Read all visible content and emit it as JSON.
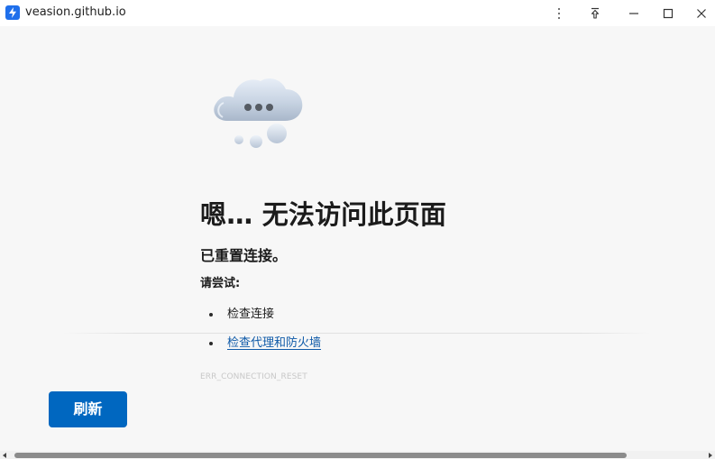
{
  "window": {
    "title": "veasion.github.io",
    "icon": "browser-app-icon",
    "controls": {
      "more": "more-options-icon",
      "pin": "pin-to-top-icon",
      "minimize": "minimize-icon",
      "maximize": "maximize-icon",
      "close": "close-icon"
    }
  },
  "error_page": {
    "illustration": "cloud-connection-error-icon",
    "headline": "嗯… 无法访问此页面",
    "subhead": "已重置连接。",
    "try_label": "请尝试:",
    "suggestions": [
      {
        "text": "检查连接",
        "is_link": false
      },
      {
        "text": "检查代理和防火墙",
        "is_link": true
      }
    ],
    "error_code": "ERR_CONNECTION_RESET",
    "refresh_button": "刷新"
  },
  "colors": {
    "page_background": "#f7f7f7",
    "title_bar_background": "#ffffff",
    "primary_button": "#0067c0",
    "link": "#0f5aa8",
    "error_code_text": "#c8c8c8"
  },
  "scrollbar": {
    "orientation": "horizontal"
  }
}
